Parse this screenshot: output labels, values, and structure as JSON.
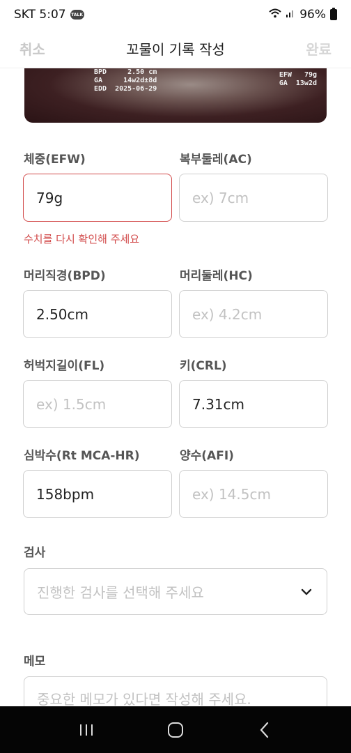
{
  "status_bar": {
    "carrier_time": "SKT 5:07",
    "talk_badge": "TALK",
    "battery": "96%",
    "icons": [
      "kakaotalk-icon",
      "wifi-icon",
      "signal-icon",
      "battery-icon"
    ]
  },
  "header": {
    "cancel_label": "취소",
    "title": "꼬물이 기록 작성",
    "done_label": "완료"
  },
  "ultrasound": {
    "left_rows": [
      {
        "key": "BPD",
        "value": "2.50 cm"
      },
      {
        "key": "GA",
        "value": "14w2d±8d"
      },
      {
        "key": "EDD",
        "value": "2025-06-29"
      }
    ],
    "right_rows": [
      {
        "key": "EFW",
        "value": "79g"
      },
      {
        "key": "GA",
        "value": "13w2d"
      }
    ]
  },
  "form": {
    "efw": {
      "label": "체중(EFW)",
      "value": "79g",
      "error": "수치를 다시 확인해 주세요"
    },
    "ac": {
      "label": "복부둘레(AC)",
      "placeholder": "ex) 7cm"
    },
    "bpd": {
      "label": "머리직경(BPD)",
      "value": "2.50cm"
    },
    "hc": {
      "label": "머리둘레(HC)",
      "placeholder": "ex) 4.2cm"
    },
    "fl": {
      "label": "허벅지길이(FL)",
      "placeholder": "ex) 1.5cm"
    },
    "crl": {
      "label": "키(CRL)",
      "value": "7.31cm"
    },
    "hr": {
      "label": "심박수(Rt MCA-HR)",
      "value": "158bpm"
    },
    "afi": {
      "label": "양수(AFI)",
      "placeholder": "ex) 14.5cm"
    },
    "exam": {
      "label": "검사",
      "placeholder": "진행한 검사를 선택해 주세요"
    },
    "memo": {
      "label": "메모",
      "placeholder": "중요한 메모가 있다면 작성해 주세요."
    }
  },
  "colors": {
    "error": "#d24a4a",
    "border": "#cfcfcf",
    "placeholder": "#c2c2c2"
  }
}
